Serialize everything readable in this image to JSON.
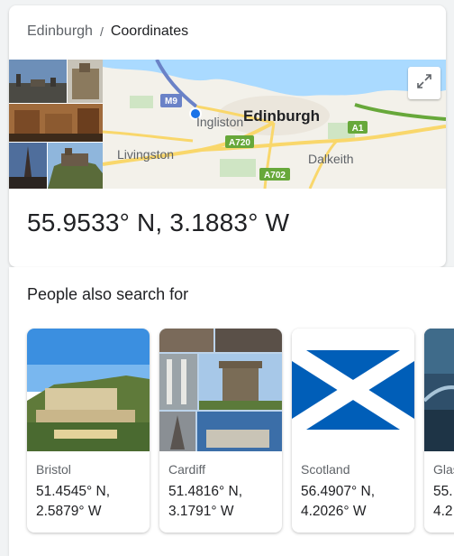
{
  "breadcrumb": {
    "parent": "Edinburgh",
    "separator": "/",
    "current": "Coordinates"
  },
  "map": {
    "labels": {
      "main_city": "Edinburgh",
      "ingliston": "Ingliston",
      "livingston": "Livingston",
      "dalkeith": "Dalkeith"
    },
    "roads": {
      "m9": "M9",
      "a720": "A720",
      "a1": "A1",
      "a702": "A702"
    },
    "expand_icon": "expand-icon"
  },
  "result": {
    "coordinates": "55.9533° N, 3.1883° W"
  },
  "people_also_search": {
    "title": "People also search for",
    "items": [
      {
        "name": "Bristol",
        "line1": "51.4545° N,",
        "line2": "2.5879° W"
      },
      {
        "name": "Cardiff",
        "line1": "51.4816° N,",
        "line2": "3.1791° W"
      },
      {
        "name": "Scotland",
        "line1": "56.4907° N,",
        "line2": "4.2026° W"
      },
      {
        "name": "Glas",
        "line1": "55.",
        "line2": "4.2"
      }
    ]
  },
  "colors": {
    "water": "#aadaff",
    "land": "#f3f1ea",
    "road_yellow": "#f9d76b",
    "road_green": "#67a83a",
    "motorway_blue": "#6a82c7",
    "scotland_flag_blue": "#005eb8"
  }
}
